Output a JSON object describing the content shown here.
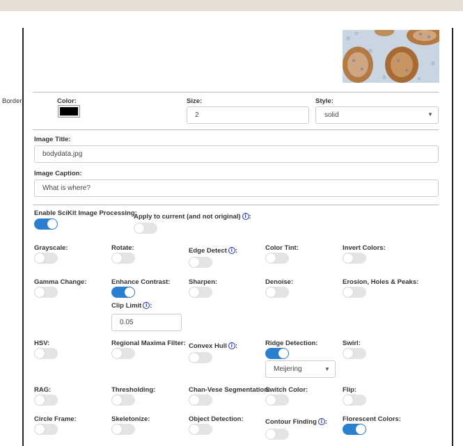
{
  "border": {
    "label": "Border:",
    "color_label": "Color:",
    "color_value": "#000000",
    "size_label": "Size:",
    "size_value": "2",
    "style_label": "Style:",
    "style_value": "solid"
  },
  "image_title": {
    "label": "Image Title:",
    "value": "bodydata.jpg"
  },
  "image_caption": {
    "label": "Image Caption:",
    "value": "What is where?"
  },
  "scikit": {
    "enable_label": "Enable SciKit Image Processing:",
    "enable_on": true,
    "apply_current_label": "Apply to current (and not original)",
    "apply_current_suffix": ":",
    "apply_current_on": false
  },
  "options": {
    "grayscale": {
      "label": "Grayscale:",
      "on": false
    },
    "rotate": {
      "label": "Rotate:",
      "on": false
    },
    "edge_detect": {
      "label": "Edge Detect",
      "suffix": ":",
      "on": false
    },
    "color_tint": {
      "label": "Color Tint:",
      "on": false
    },
    "invert_colors": {
      "label": "Invert Colors:",
      "on": false
    },
    "gamma_change": {
      "label": "Gamma Change:",
      "on": false
    },
    "enhance_contrast": {
      "label": "Enhance Contrast:",
      "on": true
    },
    "sharpen": {
      "label": "Sharpen:",
      "on": false
    },
    "denoise": {
      "label": "Denoise:",
      "on": false
    },
    "erosion": {
      "label": "Erosion, Holes & Peaks:",
      "on": false
    },
    "clip_limit": {
      "label": "Clip Limit",
      "suffix": ":",
      "value": "0.05"
    },
    "hsv": {
      "label": "HSV:",
      "on": false
    },
    "regional_maxima": {
      "label": "Regional Maxima Filter:",
      "on": false
    },
    "convex_hull": {
      "label": "Convex Hull",
      "suffix": ":",
      "on": false
    },
    "ridge_detection": {
      "label": "Ridge Detection:",
      "on": true,
      "method": "Meijering"
    },
    "swirl": {
      "label": "Swirl:",
      "on": false
    },
    "rag": {
      "label": "RAG:",
      "on": false
    },
    "thresholding": {
      "label": "Thresholding:",
      "on": false
    },
    "chan_vese": {
      "label": "Chan-Vese Segmentation:",
      "on": false
    },
    "switch_color": {
      "label": "Switch Color:",
      "on": false
    },
    "flip": {
      "label": "Flip:",
      "on": false
    },
    "circle_frame": {
      "label": "Circle Frame:",
      "on": false
    },
    "skeletonize": {
      "label": "Skeletonize:",
      "on": false
    },
    "object_detection": {
      "label": "Object Detection:",
      "on": false
    },
    "contour_finding": {
      "label": "Contour Finding",
      "suffix": ":",
      "on": false
    },
    "florescent_colors": {
      "label": "Florescent Colors:",
      "on": true
    }
  },
  "icons": {
    "info": "info-icon",
    "caret": "chevron-down-icon"
  },
  "colors": {
    "accent": "#2b7fd1",
    "info": "#1b2fb5"
  }
}
